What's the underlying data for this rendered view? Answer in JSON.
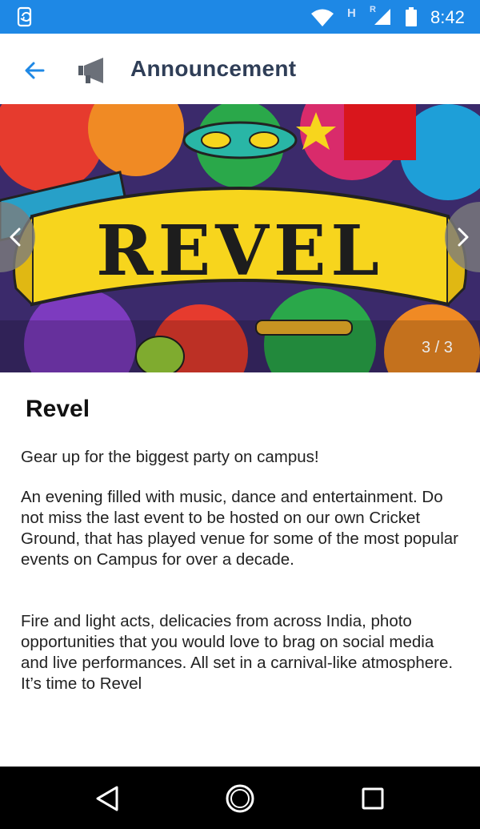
{
  "status_bar": {
    "time": "8:42",
    "network_label": "H",
    "roaming_label": "R",
    "icons": [
      "app-notification-icon",
      "wifi-icon",
      "signal-icon",
      "battery-icon"
    ]
  },
  "app_bar": {
    "title": "Announcement",
    "icons": [
      "back-arrow-icon",
      "megaphone-icon"
    ]
  },
  "banner": {
    "art_text": "REVEL",
    "counter": "3 / 3",
    "icons": [
      "chevron-left-icon",
      "chevron-right-icon"
    ]
  },
  "content": {
    "title": "Revel",
    "paragraphs": [
      "Gear up for the biggest party on campus!",
      "An evening filled with music, dance and entertainment. Do not miss the last event to be hosted on our own Cricket Ground, that has played venue for some of the most popular events on Campus for over a decade.",
      "Fire and light acts, delicacies from across India, photo opportunities that you would love to brag on social media and live performances. All set in a carnival-like atmosphere. It’s time to Revel"
    ]
  },
  "system_nav": {
    "icons": [
      "nav-back-icon",
      "nav-home-icon",
      "nav-recents-icon"
    ]
  },
  "colors": {
    "status_bar": "#1e88e5",
    "accent": "#1e88e5",
    "title_text": "#2f3e57",
    "banner_yellow": "#f7d51d"
  }
}
